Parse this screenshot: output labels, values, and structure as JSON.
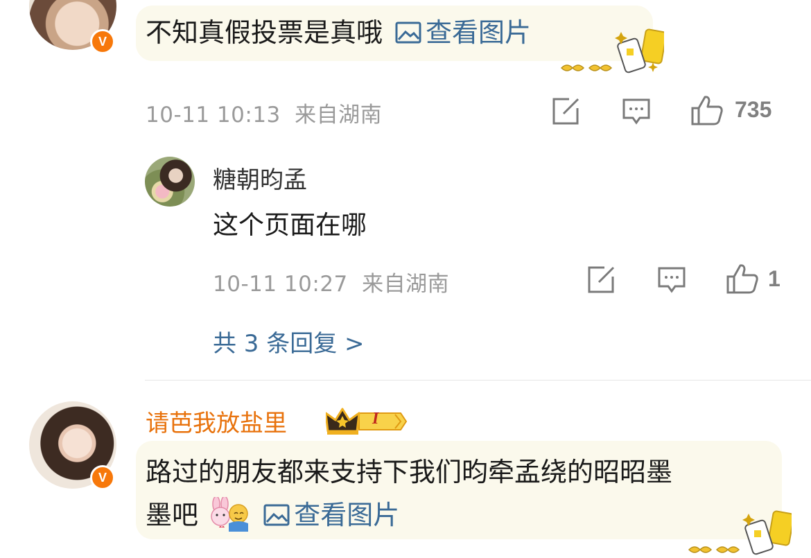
{
  "comments": [
    {
      "text": "不知真假投票是真哦",
      "view_image": "查看图片",
      "timestamp": "10-11 10:13",
      "location": "来自湖南",
      "likes": "735",
      "badge": "V",
      "replies": [
        {
          "username": "糖朝昀孟",
          "text": "这个页面在哪",
          "timestamp": "10-11 10:27",
          "location": "来自湖南",
          "likes": "1"
        }
      ],
      "more_replies": "共 3 条回复 >"
    },
    {
      "username": "请芭我放盐里",
      "rank_badge": "I",
      "badge": "V",
      "text_line1": "路过的朋友都来支持下我们昀牵孟绕的昭昭墨",
      "text_line2": "墨吧",
      "view_image": "查看图片"
    }
  ],
  "colors": {
    "link": "#3a6a96",
    "username_highlight": "#e8720c",
    "verified_badge": "#f7780a",
    "meta": "#9a9a9a",
    "bubble": "#fbf9ec"
  }
}
